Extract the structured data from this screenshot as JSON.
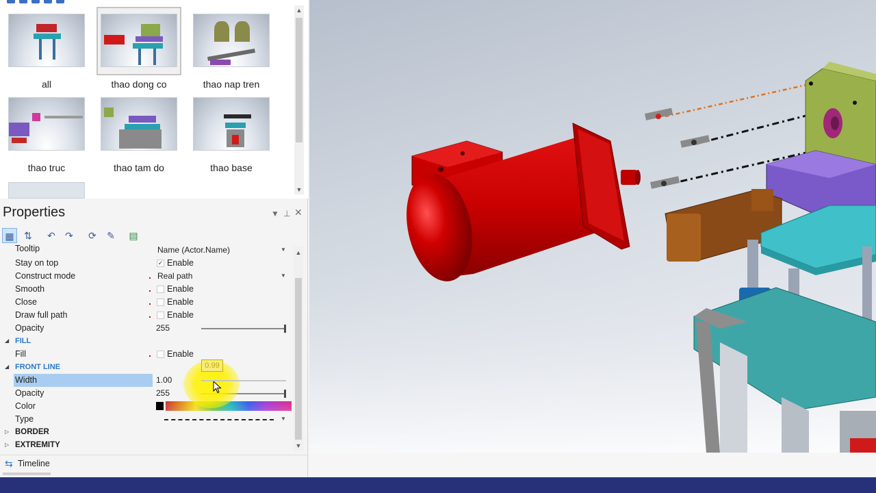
{
  "gallery": {
    "items": [
      {
        "label": "all"
      },
      {
        "label": "thao dong co",
        "selected": true
      },
      {
        "label": "thao nap tren"
      },
      {
        "label": "thao truc"
      },
      {
        "label": "thao tam do"
      },
      {
        "label": "thao base"
      }
    ]
  },
  "properties": {
    "title": "Properties",
    "rows": {
      "tooltip": {
        "name": "Tooltip",
        "value": "Name (Actor.Name)"
      },
      "stay_on_top": {
        "name": "Stay on top",
        "value": "Enable",
        "checked": true
      },
      "construct_mode": {
        "name": "Construct mode",
        "value": "Real path"
      },
      "smooth": {
        "name": "Smooth",
        "value": "Enable",
        "checked": false
      },
      "close": {
        "name": "Close",
        "value": "Enable",
        "checked": false
      },
      "draw_full_path": {
        "name": "Draw full path",
        "value": "Enable",
        "checked": false
      },
      "opacity1": {
        "name": "Opacity",
        "value": "255",
        "level": 1.0
      },
      "fill_cat": {
        "name": "FILL"
      },
      "fill": {
        "name": "Fill",
        "value": "Enable",
        "checked": false
      },
      "front_line_cat": {
        "name": "FRONT LINE"
      },
      "width": {
        "name": "Width",
        "value": "1.00"
      },
      "opacity2": {
        "name": "Opacity",
        "value": "255",
        "level": 1.0
      },
      "color": {
        "name": "Color",
        "value_color": "#000000"
      },
      "type": {
        "name": "Type"
      },
      "border_cat": {
        "name": "BORDER"
      },
      "extremity_cat": {
        "name": "EXTREMITY"
      }
    },
    "tooltip_value": "0.99"
  },
  "timeline": {
    "label": "Timeline"
  },
  "colors": {
    "accent": "#2a79c9",
    "motor": "#d40000",
    "taskbar": "#27317a",
    "selection": "#a9cdf0"
  }
}
